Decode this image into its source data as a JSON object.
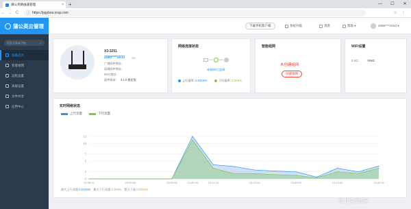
{
  "browser": {
    "tab_title": "蒲公英路由器管理",
    "tab_close": "×",
    "new_tab": "+",
    "win_controls": [
      "—",
      "☐",
      "✕"
    ],
    "nav": [
      "←",
      "→",
      "C"
    ],
    "lock": "ⓘ",
    "url": "https://pgybox.oray.com",
    "right_icons": [
      "☆",
      "⋮"
    ]
  },
  "sidebar": {
    "logo": "蒲公英云管理",
    "search_placeholder": "搜索设备或功能",
    "search_icon": "⌕",
    "items": [
      {
        "label": "设备首页",
        "icon": "home-icon",
        "active": true
      },
      {
        "label": "智能组网",
        "icon": "network-icon",
        "active": false
      },
      {
        "label": "远程设置",
        "icon": "settings-icon",
        "active": false
      },
      {
        "label": "高级设置",
        "icon": "advanced-icon",
        "active": false
      },
      {
        "label": "文件共享",
        "icon": "folder-icon",
        "active": false
      },
      {
        "label": "应用中心",
        "icon": "apps-icon",
        "active": false
      }
    ]
  },
  "topbar": {
    "download": "下载手机客户端",
    "links": [
      {
        "label": "系统升级",
        "icon": "upgrade-icon"
      },
      {
        "label": "消息",
        "icon": "message-icon"
      },
      {
        "label": "帮助 ▾",
        "icon": "help-icon"
      }
    ],
    "user": "2089****2033 ▾"
  },
  "device": {
    "model": "X3-3251",
    "sn": "2089****2033",
    "sn_suffix": "SN",
    "fields": [
      {
        "label": "广域网IP地址:",
        "value": ""
      },
      {
        "label": "局域网IP地址:",
        "value": ""
      },
      {
        "label": "MAC地址:",
        "value": ""
      },
      {
        "label": "固件版本:",
        "value": "3.1.0 稳定版"
      }
    ]
  },
  "network": {
    "title": "网络连接状态",
    "status": "未联网/已连接",
    "up_label": "上行速率:",
    "up_value": "5.52KB/s",
    "down_label": "下行速率:",
    "down_value": "2.3KB/s",
    "up_color": "#2196f3",
    "down_color": "#8bc34a"
  },
  "smart": {
    "title": "智能组网",
    "status": "未创建组网",
    "button": "创建组网"
  },
  "wifi": {
    "title": "WiFi设置",
    "band": "2.4G:",
    "ssid": "YING"
  },
  "realtime": {
    "title": "实时网络状态",
    "legend_up": "上行流量",
    "legend_down": "下行流量",
    "foot": [
      {
        "label": "最大上行流量:",
        "value": "5.52KB/s"
      },
      {
        "label": "最大下行流量:",
        "value": "2.3KB/s"
      },
      {
        "label": "累计下载:",
        "value": "0.53KB/s"
      }
    ]
  },
  "chart_data": {
    "type": "area",
    "title": "",
    "x": [
      "23:38:04",
      "23:38:34",
      "23:39:04",
      "23:39:34",
      "23:40:04",
      "23:40:34",
      "23:41:04",
      "23:41:34",
      "23:42:04",
      "23:42:34",
      "23:43:04",
      "23:43:34",
      "23:44:04",
      "23:44:34",
      "23:45:04"
    ],
    "xticks": [
      "23:38:04",
      "23:39:04",
      "23:40:04",
      "23:40:34",
      "23:41:04",
      "23:42:04",
      "23:43:04",
      "23:44:04",
      "23:45:04"
    ],
    "yticks": [
      0,
      2,
      5,
      7,
      10,
      12
    ],
    "ylim": [
      0,
      12
    ],
    "series": [
      {
        "name": "上行流量",
        "color": "#2196f3",
        "values": [
          0,
          0,
          0,
          0,
          0,
          12,
          4,
          3.5,
          2.5,
          2.2,
          2.0,
          0.5,
          3.0,
          2.0,
          3.6
        ]
      },
      {
        "name": "下行流量",
        "color": "#8bc34a",
        "values": [
          0,
          0,
          0,
          0,
          0,
          11,
          3.0,
          1.5,
          1.5,
          1.2,
          1.0,
          0.3,
          2.0,
          1.5,
          3.0
        ]
      }
    ]
  },
  "watermark": "值 什么值得买"
}
